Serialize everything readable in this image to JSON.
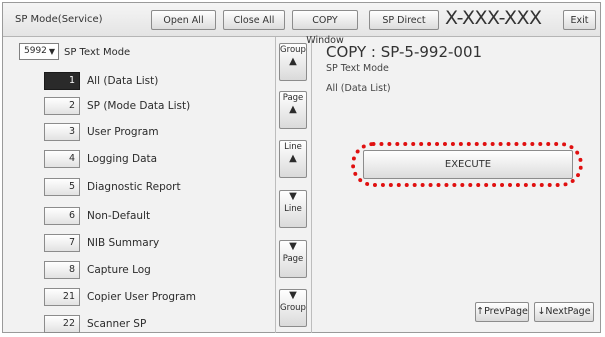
{
  "header": {
    "mode_title": "SP Mode(Service)",
    "open_all": "Open All",
    "close_all": "Close All",
    "copy_window": "COPY Window",
    "sp_direct": "SP Direct",
    "code_placeholder": "X-XXX-XXX",
    "exit": "Exit"
  },
  "left": {
    "dropdown_value": "5992",
    "dropdown_label": "SP Text Mode",
    "items": [
      {
        "num": "1",
        "label": "All (Data List)",
        "selected": true
      },
      {
        "num": "2",
        "label": "SP (Mode Data List)"
      },
      {
        "num": "3",
        "label": "User Program"
      },
      {
        "num": "4",
        "label": "Logging Data"
      },
      {
        "num": "5",
        "label": "Diagnostic Report"
      },
      {
        "num": "6",
        "label": "Non-Default"
      },
      {
        "num": "7",
        "label": "NIB Summary"
      },
      {
        "num": "8",
        "label": "Capture Log"
      },
      {
        "num": "21",
        "label": "Copier User Program"
      },
      {
        "num": "22",
        "label": "Scanner SP"
      }
    ]
  },
  "scroll": {
    "group_up": "Group",
    "page_up": "Page",
    "line_up": "Line",
    "line_down": "Line",
    "page_down": "Page",
    "group_down": "Group"
  },
  "right": {
    "title": "COPY : SP-5-992-001",
    "subtitle": "SP Text Mode",
    "subtitle2": "All (Data List)",
    "execute": "EXECUTE",
    "prev_page": "PrevPage",
    "next_page": "NextPage"
  },
  "colors": {
    "highlight_ring": "#e01010"
  }
}
